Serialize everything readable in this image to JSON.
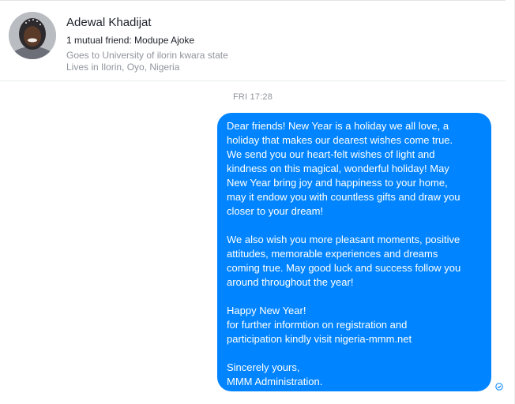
{
  "header": {
    "name": "Adewal Khadijat",
    "mutual_friends": "1 mutual friend: Modupe Ajoke",
    "education": "Goes to University of ilorin kwara state",
    "location": "Lives in Ilorin, Oyo, Nigeria",
    "avatar_icon": "profile-photo"
  },
  "conversation": {
    "timestamp": "FRI 17:28",
    "message": {
      "paragraph_1": "Dear friends! New Year is a holiday we all love, a\nholiday that makes our dearest wishes come true.\nWe send you our heart-felt wishes of light and\nkindness on this magical, wonderful holiday! May\nNew Year bring joy and happiness to your home,\nmay it endow you with countless gifts and draw you\ncloser to your dream!",
      "paragraph_2": "We also wish you more pleasant moments, positive\nattitudes, memorable experiences and dreams\ncoming true. May good luck and success follow you\naround throughout the year!",
      "paragraph_3": "Happy New Year!\nfor further informtion on registration and\nparticipation kindly visit nigeria-mmm.net",
      "paragraph_4": "Sincerely yours,\nMMM Administration."
    },
    "status_icon": "sent-check-icon"
  },
  "colors": {
    "bubble": "#0084ff",
    "meta_text": "#90949c",
    "primary_text": "#1d2129"
  }
}
